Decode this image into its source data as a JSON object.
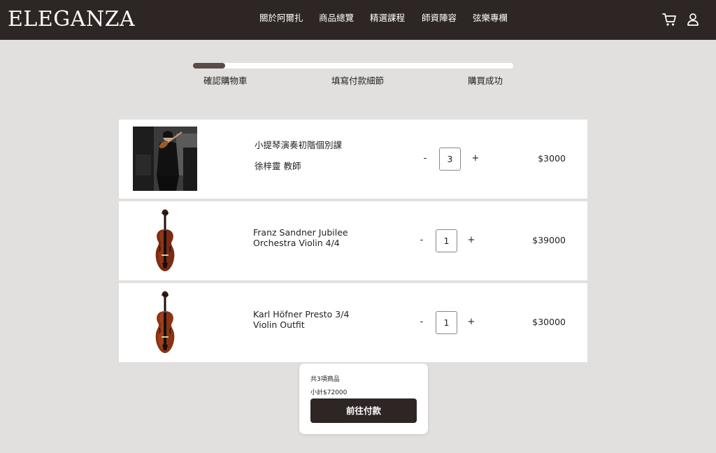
{
  "header": {
    "logo": "ELEGANZA",
    "nav": [
      "關於阿爾扎",
      "商品總覽",
      "精選課程",
      "師資陣容",
      "弦樂專欄"
    ],
    "icons": [
      "cart-icon",
      "user-icon"
    ],
    "background": "#2e2624"
  },
  "progress": {
    "steps": [
      "確認購物車",
      "填寫付款細節",
      "購買成功"
    ],
    "current_step": 1,
    "fill_fraction": 0.1
  },
  "cart": {
    "items": [
      {
        "title": "小提琴演奏初階個別課",
        "subtitle": "徐梓靈 教師",
        "qty_minus": "-",
        "qty": "3",
        "qty_plus": "+",
        "price": "$3000"
      },
      {
        "title_line1": "Franz Sandner Jubilee",
        "title_line2": "Orchestra Violin 4/4",
        "qty_minus": "-",
        "qty": "1",
        "qty_plus": "+",
        "price": "$39000"
      },
      {
        "title_line1": "Karl Höfner Presto 3/4",
        "title_line2": "Violin Outfit",
        "qty_minus": "-",
        "qty": "1",
        "qty_plus": "+",
        "price": "$30000"
      }
    ]
  },
  "summary": {
    "count": "共3項商品",
    "subtotal": "小計$72000",
    "checkout_label": "前往付款"
  },
  "colors": {
    "accent": "#2e2624",
    "progress": "#5a4b47",
    "page_bg": "#e1e0de"
  }
}
